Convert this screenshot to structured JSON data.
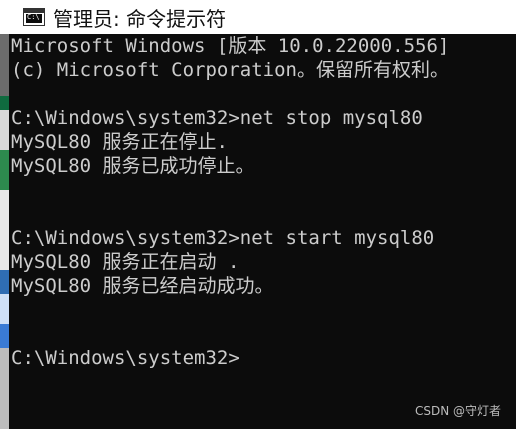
{
  "window": {
    "title": "管理员: 命令提示符",
    "icon": "command-prompt-icon",
    "icon_glyph": "C:\\"
  },
  "console": {
    "text_color": "#cccccc",
    "background": "#0c0c0c",
    "lines": [
      "Microsoft Windows [版本 10.0.22000.556]",
      "(c) Microsoft Corporation。保留所有权利。",
      "",
      "C:\\Windows\\system32>net stop mysql80",
      "MySQL80 服务正在停止.",
      "MySQL80 服务已成功停止。",
      "",
      "",
      "C:\\Windows\\system32>net start mysql80",
      "MySQL80 服务正在启动 .",
      "MySQL80 服务已经启动成功。",
      "",
      "",
      "C:\\Windows\\system32>"
    ]
  },
  "watermark": "CSDN @守灯者"
}
